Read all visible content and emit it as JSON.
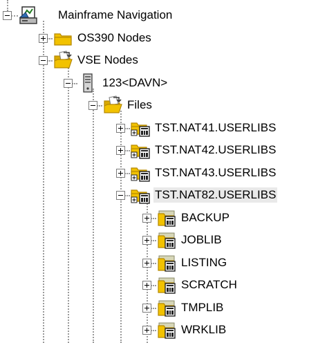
{
  "tree": {
    "root": {
      "label": "Mainframe Navigation",
      "expanded": true,
      "icon": "mainframe-icon"
    },
    "os390": {
      "label": "OS390 Nodes",
      "expanded": false,
      "icon": "closed-folder-icon"
    },
    "vse": {
      "label": "VSE Nodes",
      "expanded": true,
      "icon": "open-folder-icon"
    },
    "server": {
      "label": "123<DAVN>",
      "expanded": true,
      "icon": "server-icon"
    },
    "files": {
      "label": "Files",
      "expanded": true,
      "icon": "open-folder-icon"
    },
    "userlibs": [
      {
        "label": "TST.NAT41.USERLIBS",
        "expanded": false,
        "icon": "library-folder-icon"
      },
      {
        "label": "TST.NAT42.USERLIBS",
        "expanded": false,
        "icon": "library-folder-icon"
      },
      {
        "label": "TST.NAT43.USERLIBS",
        "expanded": false,
        "icon": "library-folder-icon"
      },
      {
        "label": "TST.NAT82.USERLIBS",
        "expanded": true,
        "selected": true,
        "icon": "library-folder-icon"
      }
    ],
    "sublibs": [
      {
        "label": "BACKUP",
        "expanded": false,
        "icon": "sublibrary-icon"
      },
      {
        "label": "JOBLIB",
        "expanded": false,
        "icon": "sublibrary-icon"
      },
      {
        "label": "LISTING",
        "expanded": false,
        "icon": "sublibrary-icon"
      },
      {
        "label": "SCRATCH",
        "expanded": false,
        "icon": "sublibrary-icon"
      },
      {
        "label": "TMPLIB",
        "expanded": false,
        "icon": "sublibrary-icon"
      },
      {
        "label": "WRKLIB",
        "expanded": false,
        "icon": "sublibrary-icon"
      }
    ]
  },
  "colors": {
    "folder": "#f2c200",
    "folder_dark": "#b58800",
    "selection": "#e9e9e9",
    "tree_lines": "#9a9a9a"
  }
}
